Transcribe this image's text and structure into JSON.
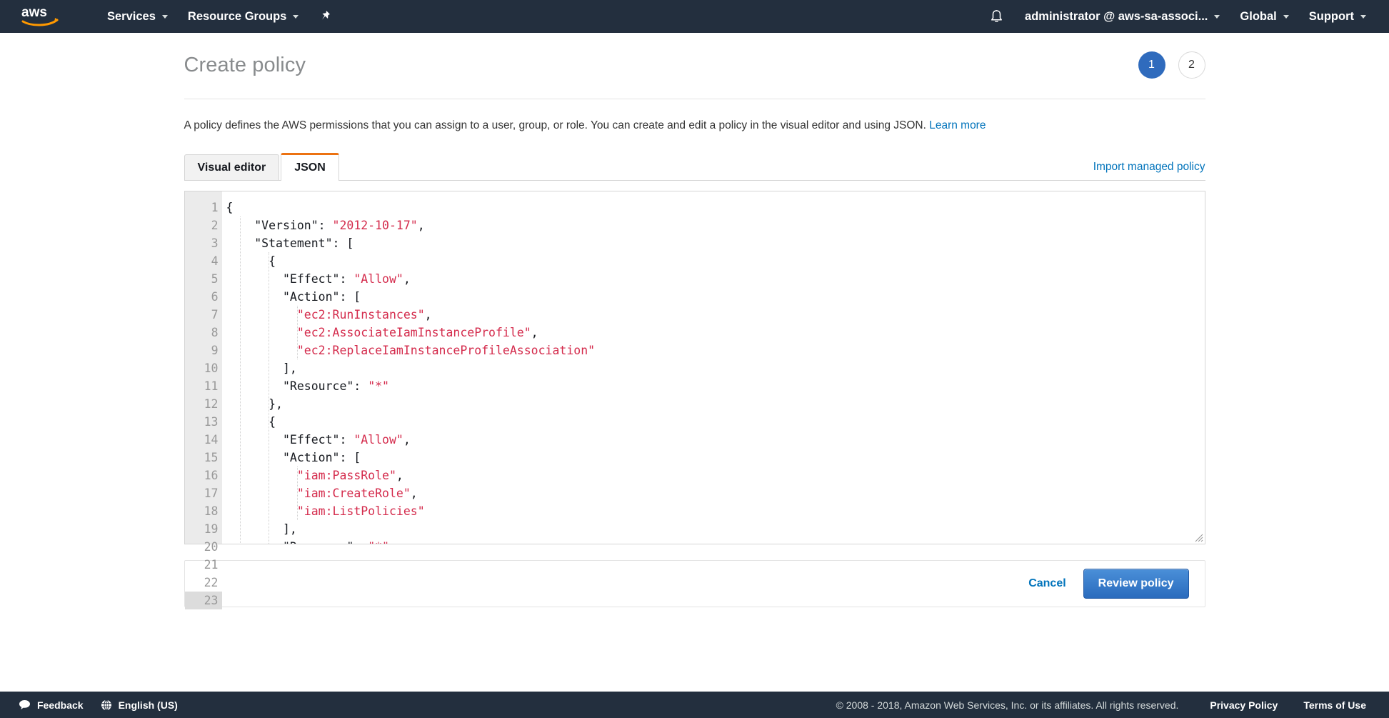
{
  "topnav": {
    "logo_alt": "aws",
    "services_label": "Services",
    "resource_groups_label": "Resource Groups",
    "pin_icon": "pin-icon",
    "bell_icon": "bell-icon",
    "account_label": "administrator @ aws-sa-associ...",
    "region_label": "Global",
    "support_label": "Support"
  },
  "header": {
    "title": "Create policy",
    "steps": [
      {
        "label": "1",
        "state": "active"
      },
      {
        "label": "2",
        "state": "inactive"
      }
    ]
  },
  "description": {
    "text": "A policy defines the AWS permissions that you can assign to a user, group, or role. You can create and edit a policy in the visual editor and using JSON.",
    "link_label": "Learn more"
  },
  "tabs": {
    "items": [
      {
        "label": "Visual editor",
        "active": false
      },
      {
        "label": "JSON",
        "active": true
      }
    ],
    "import_label": "Import managed policy",
    "active_accent": "#ec7211"
  },
  "editor": {
    "active_line": 23,
    "lines": [
      {
        "n": 1,
        "fold": true,
        "indent": 0,
        "text": "{"
      },
      {
        "n": 2,
        "fold": false,
        "indent": 0,
        "key": "    \"Version\": ",
        "str": "\"2012-10-17\"",
        "tail": ","
      },
      {
        "n": 3,
        "fold": true,
        "indent": 0,
        "text": "    \"Statement\": ["
      },
      {
        "n": 4,
        "fold": true,
        "indent": 0,
        "text": "      {"
      },
      {
        "n": 5,
        "fold": false,
        "indent": 0,
        "key": "        \"Effect\": ",
        "str": "\"Allow\"",
        "tail": ","
      },
      {
        "n": 6,
        "fold": true,
        "indent": 0,
        "text": "        \"Action\": ["
      },
      {
        "n": 7,
        "fold": false,
        "indent": 0,
        "key": "          ",
        "str": "\"ec2:RunInstances\"",
        "tail": ","
      },
      {
        "n": 8,
        "fold": false,
        "indent": 0,
        "key": "          ",
        "str": "\"ec2:AssociateIamInstanceProfile\"",
        "tail": ","
      },
      {
        "n": 9,
        "fold": false,
        "indent": 0,
        "key": "          ",
        "str": "\"ec2:ReplaceIamInstanceProfileAssociation\"",
        "tail": ""
      },
      {
        "n": 10,
        "fold": false,
        "indent": 0,
        "text": "        ],"
      },
      {
        "n": 11,
        "fold": false,
        "indent": 0,
        "key": "        \"Resource\": ",
        "str": "\"*\"",
        "tail": ""
      },
      {
        "n": 12,
        "fold": false,
        "indent": 0,
        "text": "      },"
      },
      {
        "n": 13,
        "fold": true,
        "indent": 0,
        "text": "      {"
      },
      {
        "n": 14,
        "fold": false,
        "indent": 0,
        "key": "        \"Effect\": ",
        "str": "\"Allow\"",
        "tail": ","
      },
      {
        "n": 15,
        "fold": true,
        "indent": 0,
        "text": "        \"Action\": ["
      },
      {
        "n": 16,
        "fold": false,
        "indent": 0,
        "key": "          ",
        "str": "\"iam:PassRole\"",
        "tail": ","
      },
      {
        "n": 17,
        "fold": false,
        "indent": 0,
        "key": "          ",
        "str": "\"iam:CreateRole\"",
        "tail": ","
      },
      {
        "n": 18,
        "fold": false,
        "indent": 0,
        "key": "          ",
        "str": "\"iam:ListPolicies\"",
        "tail": ""
      },
      {
        "n": 19,
        "fold": false,
        "indent": 0,
        "text": "        ],"
      },
      {
        "n": 20,
        "fold": false,
        "indent": 0,
        "key": "        \"Resource\": ",
        "str": "\"*\"",
        "tail": ""
      },
      {
        "n": 21,
        "fold": false,
        "indent": 0,
        "text": "      }"
      },
      {
        "n": 22,
        "fold": false,
        "indent": 0,
        "text": "    ]"
      },
      {
        "n": 23,
        "fold": false,
        "indent": 0,
        "text": "}",
        "caret": true
      }
    ],
    "string_color": "#d42b4c",
    "text_color": "#16191f"
  },
  "actions": {
    "cancel_label": "Cancel",
    "primary_label": "Review policy"
  },
  "footer": {
    "feedback_label": "Feedback",
    "feedback_icon": "speech-bubble-icon",
    "language_label": "English (US)",
    "language_icon": "globe-icon",
    "copyright": "© 2008 - 2018, Amazon Web Services, Inc. or its affiliates. All rights reserved.",
    "privacy_label": "Privacy Policy",
    "terms_label": "Terms of Use"
  }
}
